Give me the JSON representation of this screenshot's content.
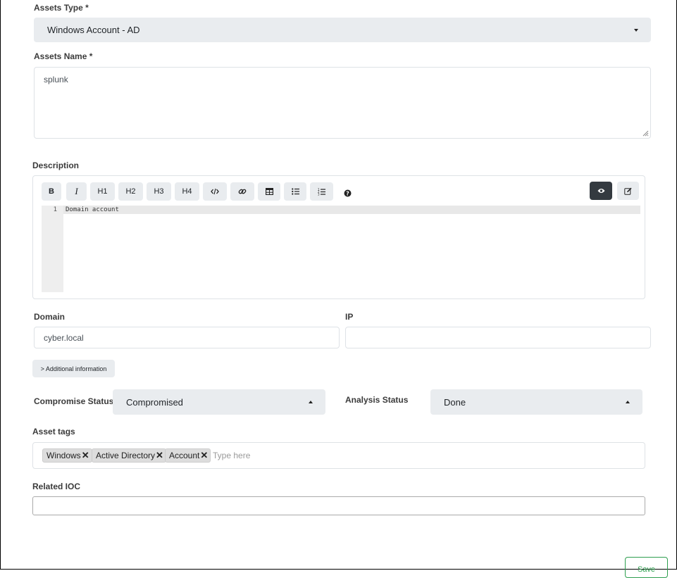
{
  "assets_type": {
    "label": "Assets Type *",
    "value": "Windows Account - AD"
  },
  "assets_name": {
    "label": "Assets Name *",
    "value": "splunk"
  },
  "description": {
    "label": "Description",
    "toolbar": {
      "bold": "B",
      "italic": "I",
      "h1": "H1",
      "h2": "H2",
      "h3": "H3",
      "h4": "H4"
    },
    "line_number": "1",
    "content": "Domain account"
  },
  "domain": {
    "label": "Domain",
    "value": "cyber.local"
  },
  "ip": {
    "label": "IP",
    "value": ""
  },
  "additional_info": {
    "label": "> Additional information"
  },
  "compromise_status": {
    "label": "Compromise Status",
    "value": "Compromised"
  },
  "analysis_status": {
    "label": "Analysis Status",
    "value": "Done"
  },
  "asset_tags": {
    "label": "Asset tags",
    "tags": [
      "Windows",
      "Active Directory",
      "Account"
    ],
    "remove_symbol": "✕",
    "placeholder": "Type here"
  },
  "related_ioc": {
    "label": "Related IOC",
    "value": ""
  },
  "save": {
    "label": "Save",
    "color": "#2e9e4f"
  },
  "colors": {
    "preview_active": "#343a40",
    "select_bg": "#e9ecef"
  }
}
